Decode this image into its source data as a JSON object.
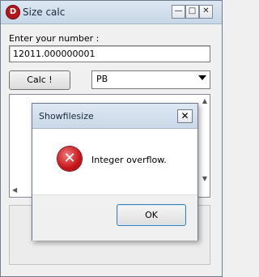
{
  "window": {
    "title": "Size calc",
    "app_icon": "D",
    "minimize_glyph": "—",
    "maximize_glyph": "□",
    "close_glyph": "✕"
  },
  "form": {
    "prompt_label": "Enter your number :",
    "number_value": "12011.000000001",
    "calc_button": "Calc !",
    "unit_selected": "PB"
  },
  "dialog": {
    "title": "Showfilesize",
    "close_glyph": "✕",
    "icon": "error-icon",
    "icon_glyph": "✕",
    "message": "Integer overflow.",
    "ok_button": "OK"
  }
}
